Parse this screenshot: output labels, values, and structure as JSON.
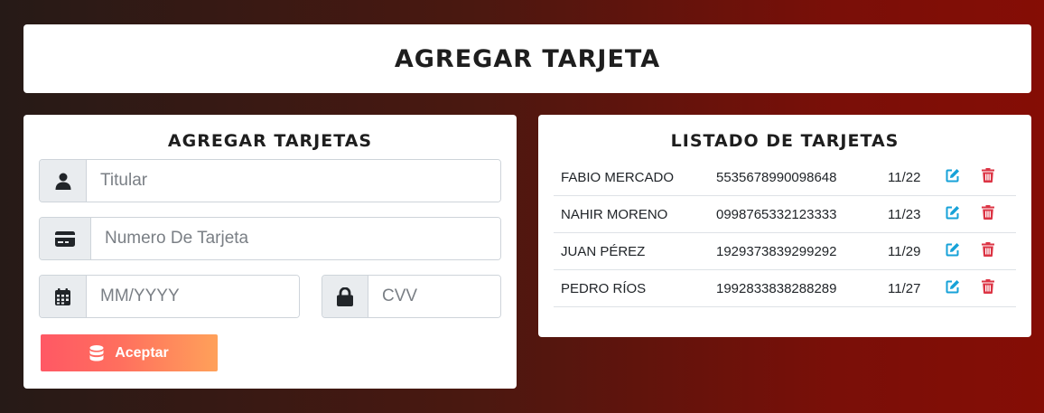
{
  "header": {
    "title": "AGREGAR TARJETA"
  },
  "form": {
    "title": "AGREGAR TARJETAS",
    "titular": {
      "placeholder": "Titular",
      "value": "",
      "icon": "user-icon"
    },
    "numero": {
      "placeholder": "Numero De Tarjeta",
      "value": "",
      "icon": "credit-card-icon"
    },
    "fecha": {
      "placeholder": "MM/YYYY",
      "value": "",
      "icon": "calendar-icon"
    },
    "cvv": {
      "placeholder": "CVV",
      "value": "",
      "icon": "lock-icon"
    },
    "submit_label": "Aceptar",
    "submit_icon": "database-icon"
  },
  "list": {
    "title": "LISTADO DE TARJETAS",
    "rows": [
      {
        "titular": "FABIO MERCADO",
        "numero": "5535678990098648",
        "fecha": "11/22"
      },
      {
        "titular": "NAHIR MORENO",
        "numero": "0998765332123333",
        "fecha": "11/23"
      },
      {
        "titular": "JUAN PÉREZ",
        "numero": "1929373839299292",
        "fecha": "11/29"
      },
      {
        "titular": "PEDRO RÍOS",
        "numero": "1992833838288289",
        "fecha": "11/27"
      }
    ],
    "edit_icon": "edit-icon",
    "delete_icon": "trash-icon"
  },
  "colors": {
    "edit": "#17a2d8",
    "delete": "#dc3545",
    "button_gradient_start": "#ff5864",
    "button_gradient_end": "#ffa15a"
  }
}
